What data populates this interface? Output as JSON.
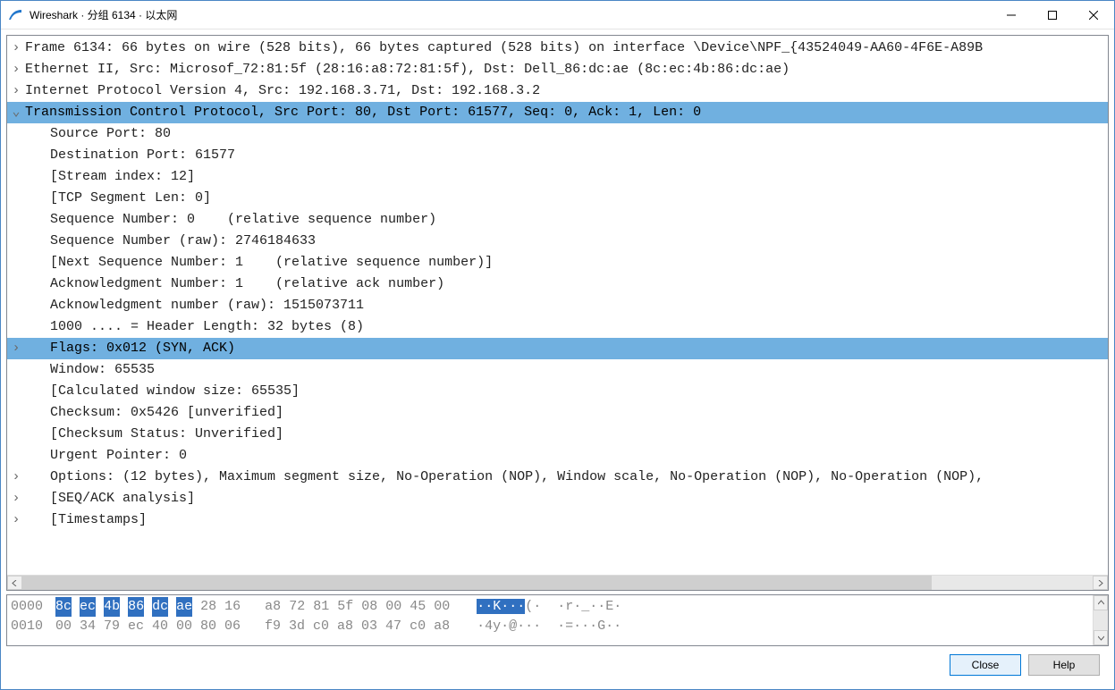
{
  "title": "Wireshark · 分组 6134 · 以太网",
  "tree": [
    {
      "indent": 0,
      "toggle": ">",
      "text": "Frame 6134: 66 bytes on wire (528 bits), 66 bytes captured (528 bits) on interface \\Device\\NPF_{43524049-AA60-4F6E-A89B"
    },
    {
      "indent": 0,
      "toggle": ">",
      "text": "Ethernet II, Src: Microsof_72:81:5f (28:16:a8:72:81:5f), Dst: Dell_86:dc:ae (8c:ec:4b:86:dc:ae)"
    },
    {
      "indent": 0,
      "toggle": ">",
      "text": "Internet Protocol Version 4, Src: 192.168.3.71, Dst: 192.168.3.2"
    },
    {
      "indent": 0,
      "toggle": "v",
      "text": "Transmission Control Protocol, Src Port: 80, Dst Port: 61577, Seq: 0, Ack: 1, Len: 0",
      "selected": true
    },
    {
      "indent": 1,
      "toggle": "",
      "text": "Source Port: 80"
    },
    {
      "indent": 1,
      "toggle": "",
      "text": "Destination Port: 61577"
    },
    {
      "indent": 1,
      "toggle": "",
      "text": "[Stream index: 12]"
    },
    {
      "indent": 1,
      "toggle": "",
      "text": "[TCP Segment Len: 0]"
    },
    {
      "indent": 1,
      "toggle": "",
      "text": "Sequence Number: 0    (relative sequence number)"
    },
    {
      "indent": 1,
      "toggle": "",
      "text": "Sequence Number (raw): 2746184633"
    },
    {
      "indent": 1,
      "toggle": "",
      "text": "[Next Sequence Number: 1    (relative sequence number)]"
    },
    {
      "indent": 1,
      "toggle": "",
      "text": "Acknowledgment Number: 1    (relative ack number)"
    },
    {
      "indent": 1,
      "toggle": "",
      "text": "Acknowledgment number (raw): 1515073711"
    },
    {
      "indent": 1,
      "toggle": "",
      "text": "1000 .... = Header Length: 32 bytes (8)"
    },
    {
      "indent": 1,
      "toggle": ">",
      "text": "Flags: 0x012 (SYN, ACK)",
      "selected": true
    },
    {
      "indent": 1,
      "toggle": "",
      "text": "Window: 65535"
    },
    {
      "indent": 1,
      "toggle": "",
      "text": "[Calculated window size: 65535]"
    },
    {
      "indent": 1,
      "toggle": "",
      "text": "Checksum: 0x5426 [unverified]"
    },
    {
      "indent": 1,
      "toggle": "",
      "text": "[Checksum Status: Unverified]"
    },
    {
      "indent": 1,
      "toggle": "",
      "text": "Urgent Pointer: 0"
    },
    {
      "indent": 1,
      "toggle": ">",
      "text": "Options: (12 bytes), Maximum segment size, No-Operation (NOP), Window scale, No-Operation (NOP), No-Operation (NOP),"
    },
    {
      "indent": 1,
      "toggle": ">",
      "text": "[SEQ/ACK analysis]"
    },
    {
      "indent": 1,
      "toggle": ">",
      "text": "[Timestamps]"
    }
  ],
  "hex": {
    "lines": [
      {
        "offset": "0000",
        "bytes": [
          {
            "t": "8c",
            "sel": true
          },
          {
            "t": " "
          },
          {
            "t": "ec",
            "sel": true
          },
          {
            "t": " "
          },
          {
            "t": "4b",
            "sel": true
          },
          {
            "t": " "
          },
          {
            "t": "86",
            "sel": true
          },
          {
            "t": " "
          },
          {
            "t": "dc",
            "sel": true
          },
          {
            "t": " "
          },
          {
            "t": "ae",
            "sel": true
          },
          {
            "t": " 28 16   a8 72 81 5f 08 00 45 00"
          }
        ],
        "ascii": [
          {
            "t": "··K···",
            "sel": true
          },
          {
            "t": "(·  ·r·_··E·"
          }
        ]
      },
      {
        "offset": "0010",
        "bytes": [
          {
            "t": "00 34 79 ec 40 00 80 06   f9 3d c0 a8 03 47 c0 a8"
          }
        ],
        "ascii": [
          {
            "t": "·4y·@···  ·=···G··"
          }
        ]
      }
    ]
  },
  "buttons": {
    "close": "Close",
    "help": "Help"
  }
}
